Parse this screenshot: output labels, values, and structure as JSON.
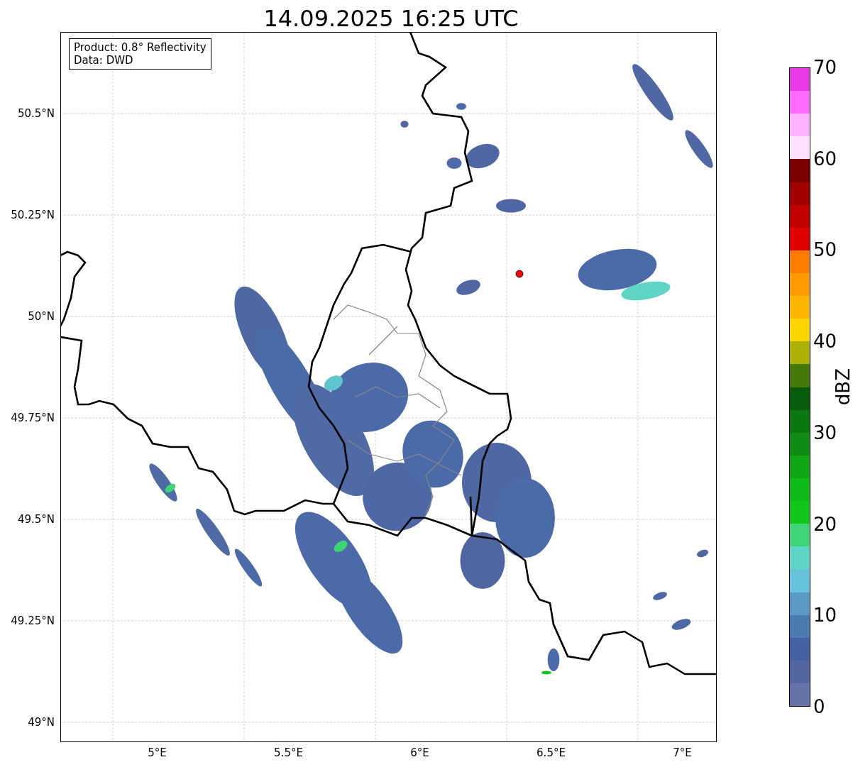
{
  "title": "14.09.2025 16:25 UTC",
  "info_box": {
    "lines": [
      "Product: 0.8° Reflectivity",
      "Data: DWD"
    ]
  },
  "map": {
    "lat_ticks": [
      "50.5°N",
      "50.25°N",
      "50°N",
      "49.75°N",
      "49.5°N",
      "49.25°N",
      "49°N"
    ],
    "lon_ticks": [
      "5°E",
      "5.5°E",
      "6°E",
      "6.5°E",
      "7°E"
    ]
  },
  "colorbar": {
    "label": "dBZ",
    "ticks": [
      "70",
      "60",
      "50",
      "40",
      "30",
      "20",
      "10",
      "0"
    ],
    "segments": [
      {
        "color": "#6573a6"
      },
      {
        "color": "#5466a0"
      },
      {
        "color": "#4361a3"
      },
      {
        "color": "#4b7bb1"
      },
      {
        "color": "#5a9ac4"
      },
      {
        "color": "#67c2dc"
      },
      {
        "color": "#5fd6c5"
      },
      {
        "color": "#3fd576"
      },
      {
        "color": "#12c71a"
      },
      {
        "color": "#0fbb19"
      },
      {
        "color": "#0fa715"
      },
      {
        "color": "#0e8c14"
      },
      {
        "color": "#0a7710"
      },
      {
        "color": "#085c0d"
      },
      {
        "color": "#457a0b"
      },
      {
        "color": "#adb006"
      },
      {
        "color": "#fcd500"
      },
      {
        "color": "#fdb600"
      },
      {
        "color": "#fe9b00"
      },
      {
        "color": "#fe7c00"
      },
      {
        "color": "#e10000"
      },
      {
        "color": "#c10000"
      },
      {
        "color": "#a20000"
      },
      {
        "color": "#7d0000"
      },
      {
        "color": "#ffe0ff"
      },
      {
        "color": "#ffb3ff"
      },
      {
        "color": "#ff6aff"
      },
      {
        "color": "#e838e8"
      }
    ]
  }
}
